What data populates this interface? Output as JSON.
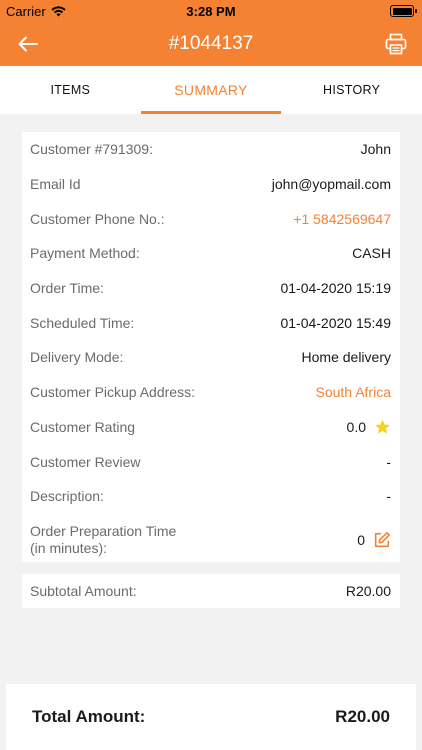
{
  "status_bar": {
    "carrier": "Carrier",
    "time": "3:28 PM"
  },
  "header": {
    "title": "#1044137",
    "back_icon": "arrow-left-icon",
    "print_icon": "printer-icon"
  },
  "tabs": [
    {
      "label": "ITEMS",
      "active": false
    },
    {
      "label": "SUMMARY",
      "active": true
    },
    {
      "label": "HISTORY",
      "active": false
    }
  ],
  "details": {
    "customer_id": {
      "label": "Customer #791309:",
      "value": "John"
    },
    "email": {
      "label": "Email Id",
      "value": "john@yopmail.com"
    },
    "phone": {
      "label": "Customer Phone No.:",
      "value": "+1 5842569647"
    },
    "payment": {
      "label": "Payment Method:",
      "value": "CASH"
    },
    "order_time": {
      "label": "Order Time:",
      "value": "01-04-2020 15:19"
    },
    "scheduled_time": {
      "label": "Scheduled Time:",
      "value": "01-04-2020 15:49"
    },
    "delivery_mode": {
      "label": "Delivery Mode:",
      "value": "Home delivery"
    },
    "pickup_address": {
      "label": "Customer Pickup Address:",
      "value": "South Africa"
    },
    "rating": {
      "label": "Customer Rating",
      "value": "0.0",
      "icon": "star-icon"
    },
    "review": {
      "label": "Customer Review",
      "value": "-"
    },
    "description": {
      "label": "Description:",
      "value": "-"
    },
    "prep_time": {
      "label_line1": "Order Preparation Time",
      "label_line2": "(in minutes):",
      "value": "0",
      "icon": "edit-icon"
    }
  },
  "subtotal": {
    "label": "Subtotal Amount:",
    "value": "R20.00"
  },
  "total": {
    "label": "Total Amount:",
    "value": "R20.00"
  },
  "colors": {
    "accent": "#f58233",
    "star": "#f7d21c",
    "background": "#f2f2f2"
  }
}
